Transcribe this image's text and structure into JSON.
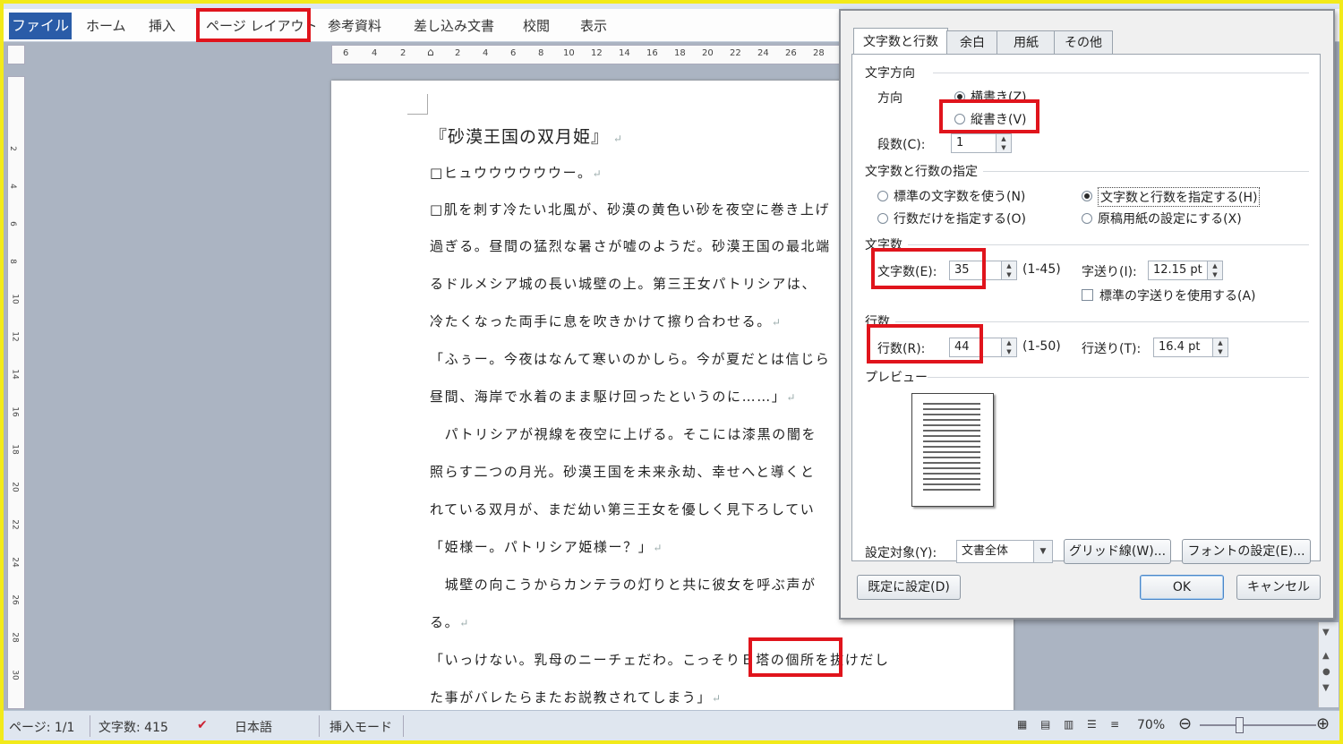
{
  "ribbon": {
    "tabs": [
      "ファイル",
      "ホーム",
      "挿入",
      "ページ レイアウト",
      "参考資料",
      "差し込み文書",
      "校閲",
      "表示"
    ]
  },
  "ruler": {
    "ticks": [
      "6",
      "4",
      "2",
      "2",
      "4",
      "6",
      "8",
      "10",
      "12",
      "14",
      "16",
      "18",
      "20",
      "22",
      "24",
      "26",
      "28"
    ],
    "vticks": [
      "2",
      "4",
      "6",
      "8",
      "10",
      "12",
      "14",
      "16",
      "18",
      "20",
      "22",
      "24",
      "26",
      "28",
      "30"
    ]
  },
  "document": {
    "title": "『砂漠王国の双月姫』",
    "lines": [
      "□ヒュウウウウウウー。",
      "□肌を刺す冷たい北風が、砂漠の黄色い砂を夜空に巻き上げ",
      "過ぎる。昼間の猛烈な暑さが嘘のようだ。砂漠王国の最北端",
      "るドルメシア城の長い城壁の上。第三王女パトリシアは、",
      "冷たくなった両手に息を吹きかけて擦り合わせる。",
      "「ふぅー。今夜はなんて寒いのかしら。今が夏だとは信じら",
      "昼間、海岸で水着のまま駆け回ったというのに……」",
      "　パトリシアが視線を夜空に上げる。そこには漆黒の闇を",
      "照らす二つの月光。砂漠王国を未来永劫、幸せへと導くと",
      "れている双月が、まだ幼い第三王女を優しく見下ろしてい",
      "「姫様ー。パトリシア姫様ー？」",
      "　城壁の向こうからカンテラの灯りと共に彼女を呼ぶ声が",
      "る。",
      "「いっけない。乳母のニーチェだわ。こっそりＢ塔の個所を抜けだし",
      "た事がバレたらまたお説教されてしまう」"
    ]
  },
  "status": {
    "page": "ページ: 1/1",
    "words": "文字数: 415",
    "language": "日本語",
    "mode": "挿入モード",
    "zoom": "70%"
  },
  "dialog": {
    "tabs": [
      "文字数と行数",
      "余白",
      "用紙",
      "その他"
    ],
    "text_direction_group": "文字方向",
    "direction_label": "方向",
    "horizontal": "横書き(Z)",
    "vertical": "縦書き(V)",
    "columns_label": "段数(C):",
    "columns_value": "1",
    "grid_group": "文字数と行数の指定",
    "opt_standard": "標準の文字数を使う(N)",
    "opt_lines_only": "行数だけを指定する(O)",
    "opt_chars_lines": "文字数と行数を指定する(H)",
    "opt_manuscript": "原稿用紙の設定にする(X)",
    "chars_group": "文字数",
    "chars_label": "文字数(E):",
    "chars_value": "35",
    "chars_range": "(1-45)",
    "char_pitch_label": "字送り(I):",
    "char_pitch_value": "12.15 pt",
    "use_standard_pitch": "標準の字送りを使用する(A)",
    "lines_group": "行数",
    "lines_label": "行数(R):",
    "lines_value": "44",
    "lines_range": "(1-50)",
    "line_pitch_label": "行送り(T):",
    "line_pitch_value": "16.4 pt",
    "preview_label": "プレビュー",
    "apply_to_label": "設定対象(Y):",
    "apply_to_value": "文書全体",
    "grid_button": "グリッド線(W)...",
    "font_button": "フォントの設定(E)...",
    "default_button": "既定に設定(D)",
    "ok_button": "OK",
    "cancel_button": "キャンセル"
  }
}
